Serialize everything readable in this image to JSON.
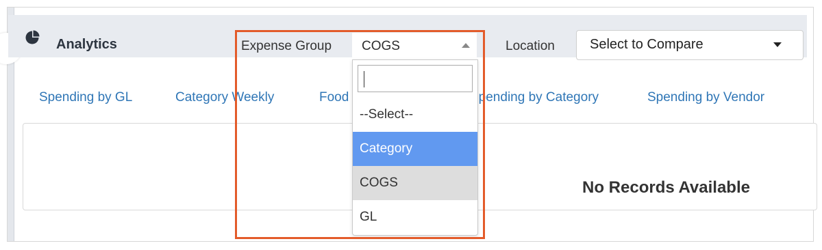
{
  "header": {
    "title": "Analytics",
    "icon": "pie-chart-icon"
  },
  "filters": {
    "expense_group_label": "Expense Group",
    "expense_group_value": "COGS",
    "location_label": "Location",
    "location_value": "Select to Compare"
  },
  "tabs": [
    {
      "label": "Spending by GL"
    },
    {
      "label": "Category Weekly"
    },
    {
      "label": "Food"
    },
    {
      "label": "Spending by Category"
    },
    {
      "label": "Spending by Vendor"
    }
  ],
  "main": {
    "empty_message": "No Records Available"
  },
  "dropdown": {
    "search_value": "",
    "options": [
      {
        "label": "--Select--",
        "state": "normal"
      },
      {
        "label": "Category",
        "state": "highlighted"
      },
      {
        "label": "COGS",
        "state": "selected"
      },
      {
        "label": "GL",
        "state": "normal"
      }
    ]
  },
  "colors": {
    "accent_link": "#2f76b6",
    "highlight": "#6199f0",
    "annotation_outline": "#e35b2a",
    "header_bg": "#e8ebf0"
  }
}
